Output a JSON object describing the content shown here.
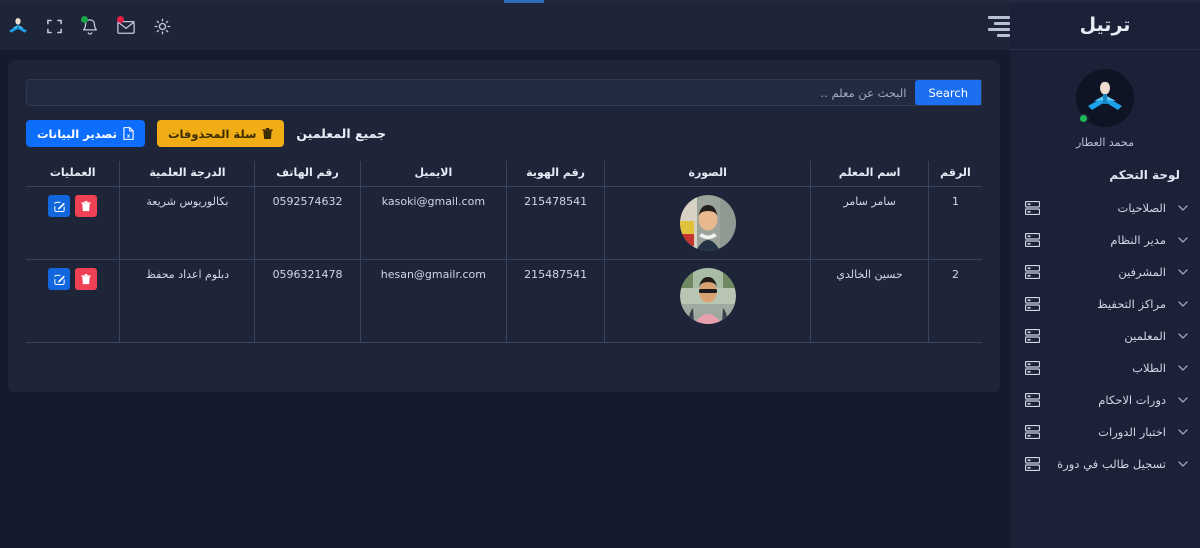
{
  "colors": {
    "page_bg": "#151a2d",
    "sidebar_bg": "#1b2238",
    "panel_bg": "#1e2539",
    "accent_blue": "#1b6ff0",
    "warning_yellow": "#f0ad16",
    "danger_red": "#ef4056",
    "online_green": "#1db954",
    "border": "#39425e"
  },
  "sidebar": {
    "brand": "ترتيل",
    "profile": {
      "name": "محمد العطار",
      "status": "online"
    },
    "menu_heading": "لوحة التحكم",
    "items": [
      {
        "label": "الصلاحيات",
        "icon": "server-icon",
        "chevron": "chevron-down-icon"
      },
      {
        "label": "مدير النظام",
        "icon": "server-icon",
        "chevron": "chevron-down-icon"
      },
      {
        "label": "المشرفين",
        "icon": "server-icon",
        "chevron": "chevron-down-icon"
      },
      {
        "label": "مراكز التحفيظ",
        "icon": "server-icon",
        "chevron": "chevron-down-icon"
      },
      {
        "label": "المعلمين",
        "icon": "server-icon",
        "chevron": "chevron-down-icon"
      },
      {
        "label": "الطلاب",
        "icon": "server-icon",
        "chevron": "chevron-down-icon"
      },
      {
        "label": "دورات الاحكام",
        "icon": "server-icon",
        "chevron": "chevron-down-icon"
      },
      {
        "label": "اختبار الدورات",
        "icon": "server-icon",
        "chevron": "chevron-down-icon"
      },
      {
        "label": "تسجيل طالب في دورة",
        "icon": "server-icon",
        "chevron": "chevron-down-icon"
      }
    ]
  },
  "header": {
    "icons": [
      {
        "name": "app-logo-icon",
        "badge": null
      },
      {
        "name": "fullscreen-icon",
        "badge": null
      },
      {
        "name": "bell-icon",
        "badge": "green"
      },
      {
        "name": "envelope-icon",
        "badge": "red"
      },
      {
        "name": "brightness-icon",
        "badge": null
      }
    ],
    "menu_toggle": "hamburger-icon"
  },
  "search": {
    "placeholder": "البحث عن معلم ..",
    "value": "",
    "button_label": "Search"
  },
  "toolbar": {
    "page_title": "جميع المعلمين",
    "export_label": "تصدير البيانات",
    "export_icon": "file-export-icon",
    "trash_label": "سلة المحذوفات",
    "trash_icon": "trash-icon"
  },
  "table": {
    "columns": [
      "الرقم",
      "اسم المعلم",
      "الصورة",
      "رقم الهوية",
      "الايميل",
      "رقم الهاتف",
      "الدرجة العلمية",
      "العمليات"
    ],
    "rows": [
      {
        "num": "1",
        "name": "سامر سامر",
        "photo": "teacher-photo-1",
        "id_number": "215478541",
        "email": "kasoki@gmail.com",
        "phone": "0592574632",
        "degree": "بكالوريوس شريعة",
        "actions": {
          "delete": "trash-icon",
          "edit": "pencil-square-icon"
        }
      },
      {
        "num": "2",
        "name": "حسين الخالدي",
        "photo": "teacher-photo-2",
        "id_number": "215487541",
        "email": "hesan@gmailr.com",
        "phone": "0596321478",
        "degree": "دبلوم اعداد محفظ",
        "actions": {
          "delete": "trash-icon",
          "edit": "pencil-square-icon"
        }
      }
    ]
  },
  "loading_bar": {
    "visible": true
  }
}
